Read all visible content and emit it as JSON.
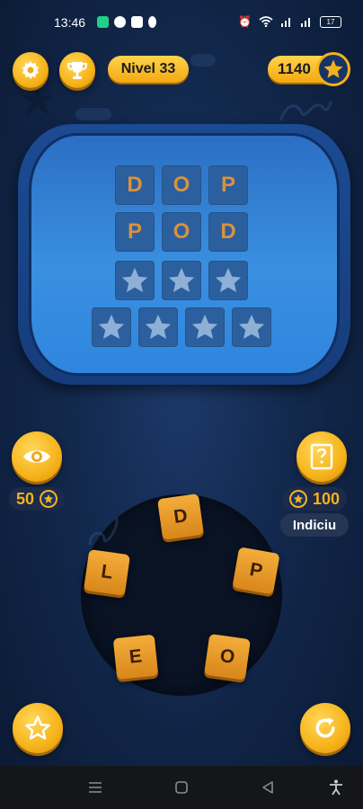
{
  "status_bar": {
    "time": "13:46",
    "battery": "17"
  },
  "top_bar": {
    "level_label": "Nivel 33",
    "coins": "1140"
  },
  "board": {
    "rows": [
      {
        "letters": [
          "D",
          "O",
          "P"
        ],
        "revealed": [
          true,
          true,
          true
        ]
      },
      {
        "letters": [
          "P",
          "O",
          "D"
        ],
        "revealed": [
          true,
          true,
          true
        ]
      },
      {
        "letters": [
          "",
          "",
          ""
        ],
        "revealed": [
          false,
          false,
          false
        ]
      },
      {
        "letters": [
          "",
          "",
          "",
          ""
        ],
        "revealed": [
          false,
          false,
          false,
          false
        ]
      }
    ]
  },
  "reveal": {
    "price": "50"
  },
  "hint": {
    "price": "100",
    "label": "Indiciu"
  },
  "wheel": {
    "letters": [
      "D",
      "P",
      "O",
      "E",
      "L"
    ]
  },
  "colors": {
    "gold": "#f4b21c",
    "tile_blue": "#2c5f9d",
    "letter_orange": "#d9923f",
    "board_blue": "#3a8fe0"
  },
  "icons": {
    "settings": "gear-icon",
    "trophy": "trophy-icon",
    "coin": "star-icon",
    "reveal": "eye-icon",
    "hint": "book-question-icon",
    "favorite": "star-outline-icon",
    "refresh": "refresh-icon"
  }
}
